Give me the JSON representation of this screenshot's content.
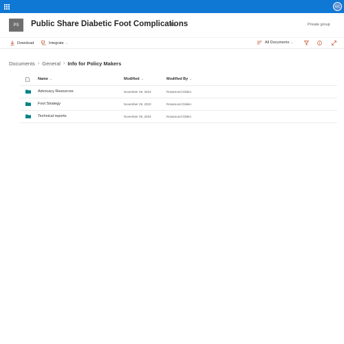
{
  "suite": {
    "avatar_initials": "GC"
  },
  "site": {
    "logo_initials": "PS",
    "title": "Public Share Diabetic Foot Complications",
    "privacy": "Private group"
  },
  "commands": {
    "download": "Download",
    "integrate": "Integrate",
    "view": "All Documents"
  },
  "breadcrumb": {
    "items": [
      "Documents",
      "General"
    ],
    "current": "Info for Policy Makers"
  },
  "list": {
    "columns": {
      "name": "Name",
      "modified": "Modified",
      "modified_by": "Modified By"
    },
    "rows": [
      {
        "name": "Advocacy Resources",
        "modified": "November 29, 2023",
        "modified_by": "Rosamond Gilden"
      },
      {
        "name": "Foot Strategy",
        "modified": "November 29, 2023",
        "modified_by": "Rosamond Gilden"
      },
      {
        "name": "Technical reports",
        "modified": "November 29, 2023",
        "modified_by": "Rosamond Gilden"
      }
    ]
  },
  "colors": {
    "suite_bar": "#0f78d4",
    "folder": "#038387",
    "command_icon": "#c8502d"
  }
}
